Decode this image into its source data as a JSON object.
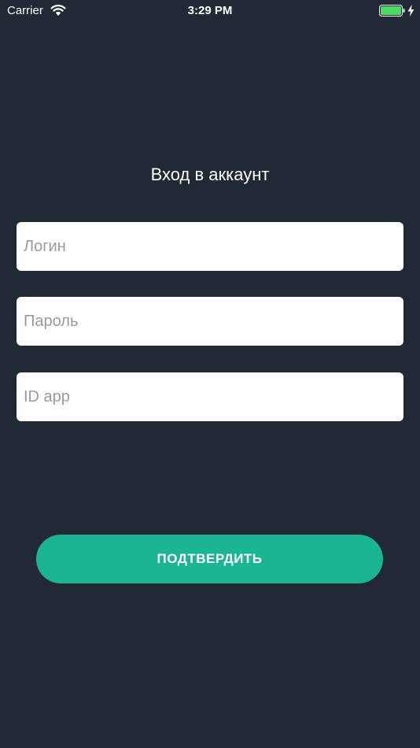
{
  "status_bar": {
    "carrier": "Carrier",
    "time": "3:29 PM",
    "wifi_icon": "wifi-icon",
    "battery_icon": "battery-icon",
    "charging_icon": "charging-bolt-icon",
    "battery_color": "#4cd964"
  },
  "screen": {
    "title": "Вход в аккаунт",
    "background_color": "#212a34"
  },
  "form": {
    "login": {
      "placeholder": "Логин",
      "value": ""
    },
    "password": {
      "placeholder": "Пароль",
      "value": ""
    },
    "app_id": {
      "placeholder": "ID app",
      "value": ""
    }
  },
  "actions": {
    "confirm_label": "ПОДТВЕРДИТЬ",
    "confirm_color": "#1bb594"
  }
}
